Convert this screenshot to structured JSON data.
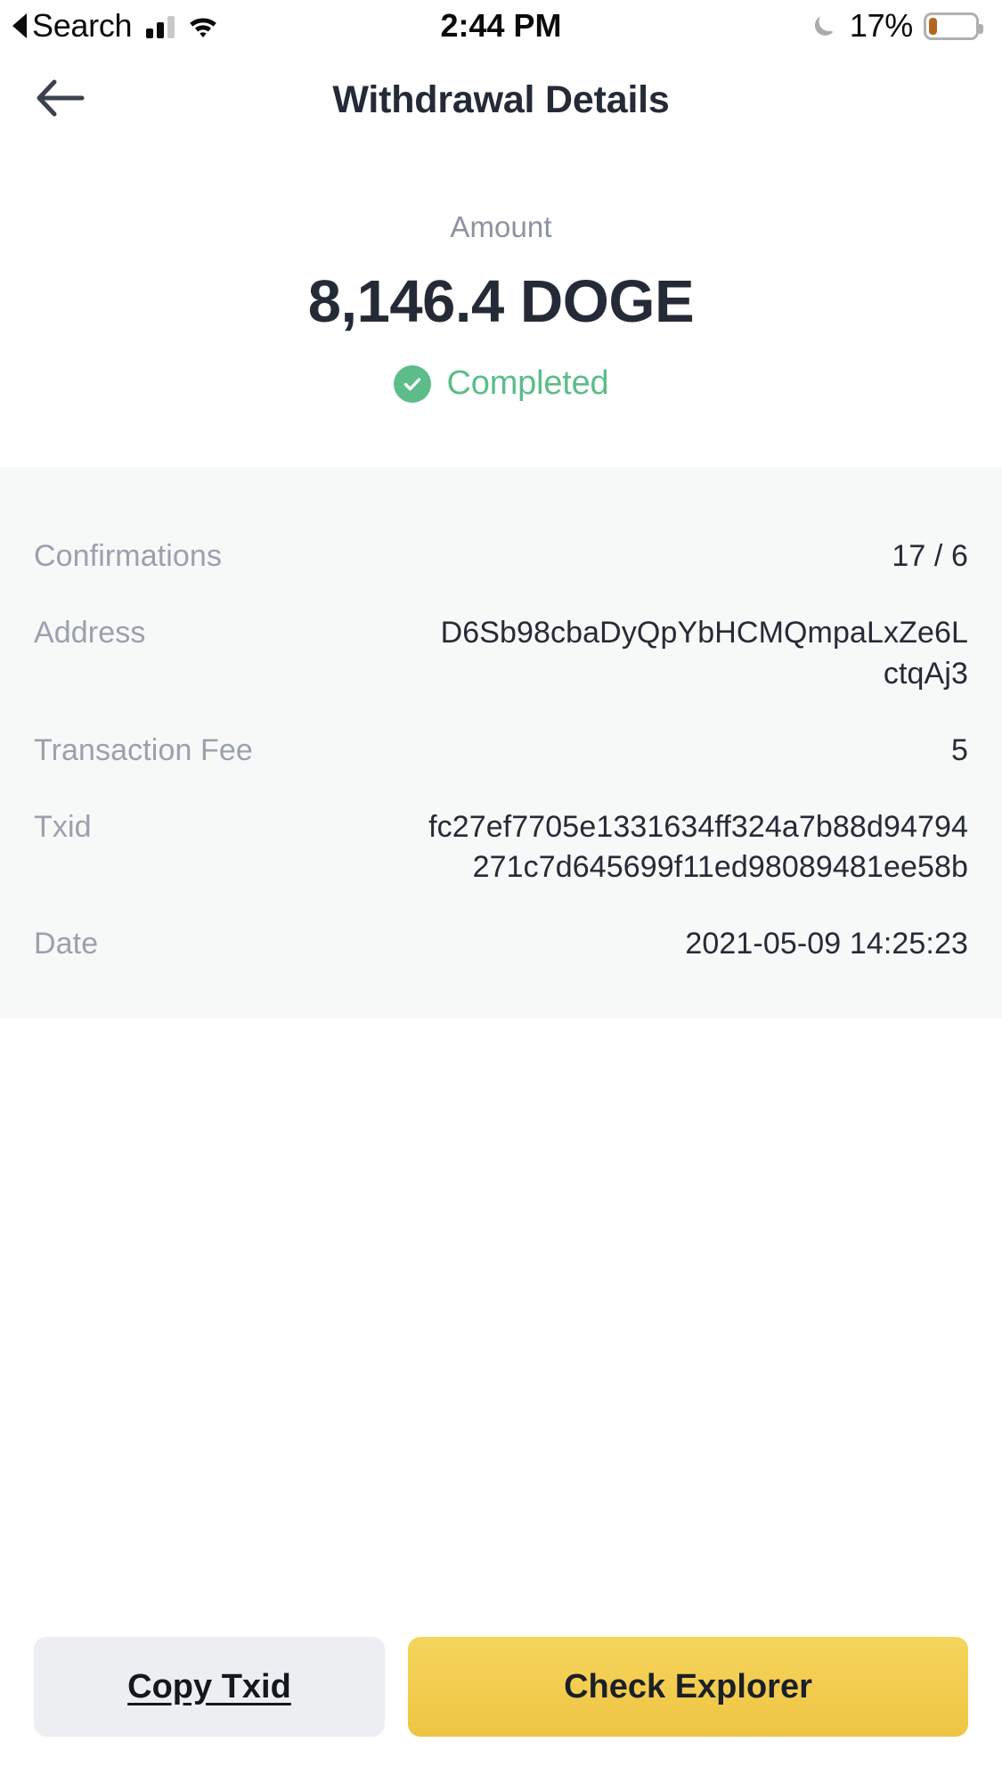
{
  "status_bar": {
    "back_label": "Search",
    "back_caret_icon": "left-triangle-icon",
    "signal_icon": "cellular-signal-icon",
    "wifi_icon": "wifi-icon",
    "time": "2:44 PM",
    "dnd_icon": "crescent-moon-icon",
    "battery_percent": "17%",
    "battery_icon": "battery-low-icon",
    "battery_level": 17,
    "battery_color": "#b5651d"
  },
  "header": {
    "back_icon": "arrow-left-icon",
    "title": "Withdrawal Details"
  },
  "summary": {
    "amount_label": "Amount",
    "amount_value": "8,146.4 DOGE",
    "status_icon": "check-circle-icon",
    "status_text": "Completed",
    "status_color": "#5cbd8a"
  },
  "details": {
    "rows": [
      {
        "label": "Confirmations",
        "value": "17 / 6"
      },
      {
        "label": "Address",
        "value": "D6Sb98cbaDyQpYbHCMQmpaLxZe6LctqAj3"
      },
      {
        "label": "Transaction Fee",
        "value": "5"
      },
      {
        "label": "Txid",
        "value": "fc27ef7705e1331634ff324a7b88d94794271c7d645699f11ed98089481ee58b"
      },
      {
        "label": "Date",
        "value": "2021-05-09 14:25:23"
      }
    ]
  },
  "footer": {
    "copy_txid_label": "Copy Txid",
    "check_explorer_label": "Check Explorer",
    "primary_color": "#efc443"
  }
}
